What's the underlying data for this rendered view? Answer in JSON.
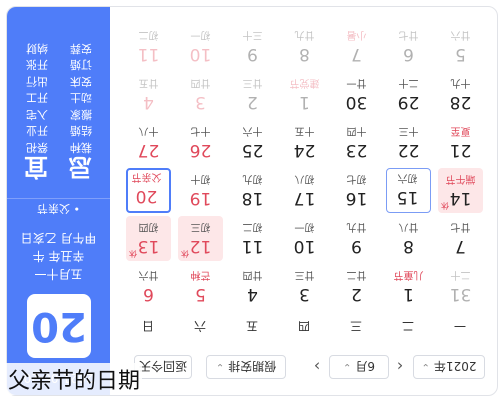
{
  "sidebar": {
    "date": "2021-06-20",
    "day": "20",
    "lunar_lines": [
      "五月十一",
      "辛丑年 牛",
      "甲午月 乙亥日"
    ],
    "festival": "• 父亲节",
    "yi_title": "宜",
    "ji_title": "忌",
    "yi_items": [
      "祭祀",
      "开业",
      "入宅",
      "开工",
      "出行",
      "开张",
      "纳财"
    ],
    "ji_items": [
      "栽种",
      "结婚",
      "搬家",
      "动土",
      "安床",
      "订婚",
      "安葬"
    ]
  },
  "toolbar": {
    "year": "2021年",
    "month": "6月",
    "holiday": "假期安排",
    "today": "返回今天"
  },
  "weekdays": [
    "一",
    "二",
    "三",
    "四",
    "五",
    "六",
    "日"
  ],
  "weeks": [
    [
      {
        "n": "31",
        "l": "二十",
        "f": true
      },
      {
        "n": "1",
        "l": "儿童节",
        "h": true
      },
      {
        "n": "2",
        "l": "廿二"
      },
      {
        "n": "3",
        "l": "廿三"
      },
      {
        "n": "4",
        "l": "廿四"
      },
      {
        "n": "5",
        "l": "芒种",
        "h": true,
        "w": true
      },
      {
        "n": "6",
        "l": "廿六",
        "w": true
      }
    ],
    [
      {
        "n": "7",
        "l": "廿七"
      },
      {
        "n": "8",
        "l": "廿八"
      },
      {
        "n": "9",
        "l": "廿九"
      },
      {
        "n": "10",
        "l": "初一"
      },
      {
        "n": "11",
        "l": "初二"
      },
      {
        "n": "12",
        "l": "初三",
        "w": true,
        "r": true
      },
      {
        "n": "13",
        "l": "初四",
        "w": true,
        "r": true
      }
    ],
    [
      {
        "n": "14",
        "l": "端午节",
        "h": true,
        "r": true
      },
      {
        "n": "15",
        "l": "初六",
        "s": true
      },
      {
        "n": "16",
        "l": "初七"
      },
      {
        "n": "17",
        "l": "初八"
      },
      {
        "n": "18",
        "l": "初九"
      },
      {
        "n": "19",
        "l": "初十",
        "w": true
      },
      {
        "n": "20",
        "l": "父亲节",
        "w": true,
        "h": true,
        "t": true
      }
    ],
    [
      {
        "n": "21",
        "l": "夏至",
        "h": true
      },
      {
        "n": "22",
        "l": "十三"
      },
      {
        "n": "23",
        "l": "十四"
      },
      {
        "n": "24",
        "l": "十五"
      },
      {
        "n": "25",
        "l": "十六"
      },
      {
        "n": "26",
        "l": "十七",
        "w": true
      },
      {
        "n": "27",
        "l": "十八",
        "w": true
      }
    ],
    [
      {
        "n": "28",
        "l": "十九"
      },
      {
        "n": "29",
        "l": "二十"
      },
      {
        "n": "30",
        "l": "廿一"
      },
      {
        "n": "1",
        "l": "建党节",
        "h": true,
        "f": true
      },
      {
        "n": "2",
        "l": "廿三",
        "f": true
      },
      {
        "n": "3",
        "l": "廿四",
        "f": true,
        "w": true
      },
      {
        "n": "4",
        "l": "廿五",
        "f": true,
        "w": true
      }
    ],
    [
      {
        "n": "5",
        "l": "廿六",
        "f": true
      },
      {
        "n": "6",
        "l": "廿七",
        "f": true
      },
      {
        "n": "7",
        "l": "小暑",
        "f": true,
        "h": true
      },
      {
        "n": "8",
        "l": "廿九",
        "f": true
      },
      {
        "n": "9",
        "l": "三十",
        "f": true
      },
      {
        "n": "10",
        "l": "初一",
        "f": true,
        "w": true
      },
      {
        "n": "11",
        "l": "初二",
        "f": true,
        "w": true
      }
    ]
  ],
  "badges": {
    "rest": "休"
  },
  "caption": "父亲节的日期"
}
